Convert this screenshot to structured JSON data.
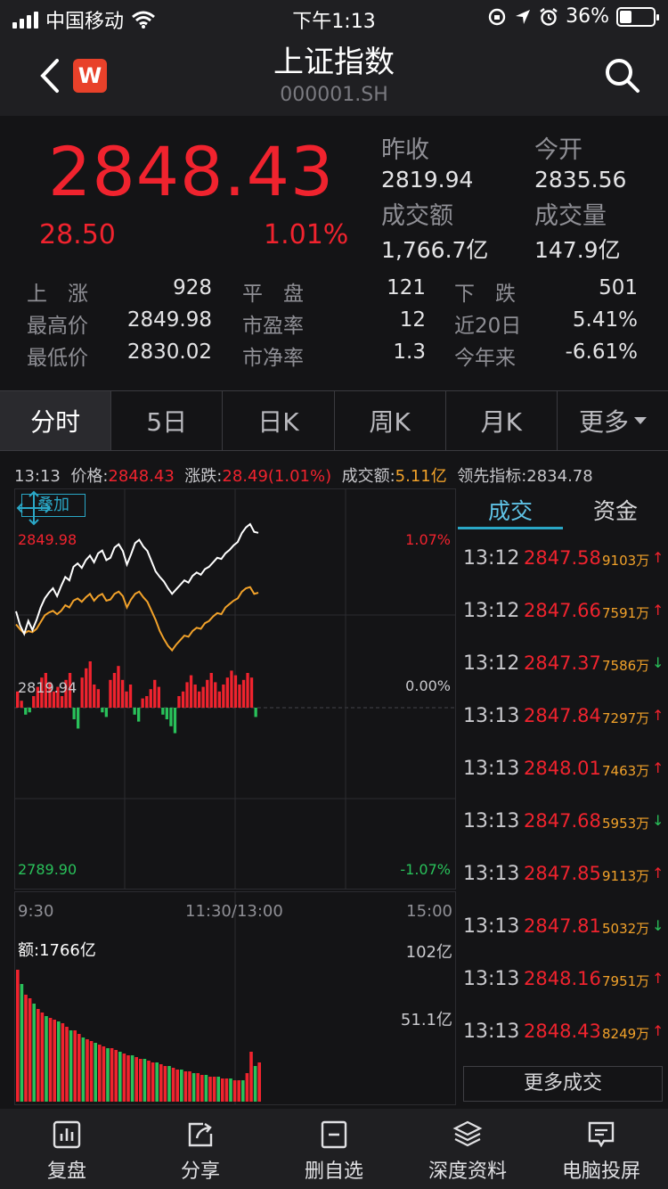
{
  "status_bar": {
    "carrier": "中国移动",
    "time": "下午1:13",
    "battery": "36%",
    "battery_level": 0.36
  },
  "header": {
    "title": "上证指数",
    "code": "000001.SH",
    "logo_text": "W"
  },
  "quote": {
    "price": "2848.43",
    "change": "28.50",
    "change_pct": "1.01%",
    "prev_close_label": "昨收",
    "prev_close": "2819.94",
    "open_label": "今开",
    "open": "2835.56",
    "turnover_label": "成交额",
    "turnover": "1,766.7亿",
    "volume_label": "成交量",
    "volume": "147.9亿"
  },
  "stats": [
    [
      {
        "label": "上　涨",
        "value": "928"
      },
      {
        "label": "平　盘",
        "value": "121"
      },
      {
        "label": "下　跌",
        "value": "501"
      }
    ],
    [
      {
        "label": "最高价",
        "value": "2849.98"
      },
      {
        "label": "市盈率",
        "value": "12"
      },
      {
        "label": "近20日",
        "value": "5.41%"
      }
    ],
    [
      {
        "label": "最低价",
        "value": "2830.02"
      },
      {
        "label": "市净率",
        "value": "1.3"
      },
      {
        "label": "今年来",
        "value": "-6.61%"
      }
    ]
  ],
  "tabs": [
    {
      "label": "分时"
    },
    {
      "label": "5日"
    },
    {
      "label": "日K"
    },
    {
      "label": "周K"
    },
    {
      "label": "月K"
    },
    {
      "label": "更多"
    }
  ],
  "info_line": {
    "time": "13:13",
    "price_label": "价格:",
    "price": "2848.43",
    "change_label": "涨跌:",
    "change": "28.49(1.01%)",
    "turnover_label": "成交额:",
    "turnover": "5.11亿",
    "lead_label": "领先指标:",
    "lead": "2834.78"
  },
  "chart": {
    "overlay_label": "叠加",
    "y_top": "2849.98",
    "y_mid": "2819.94",
    "y_bottom": "2789.90",
    "pct_top": "1.07%",
    "pct_mid": "0.00%",
    "pct_bottom": "-1.07%",
    "x_start": "9:30",
    "x_mid": "11:30/13:00",
    "x_end": "15:00",
    "amount_label": "额:1766亿",
    "amount_top": "102亿",
    "amount_mid": "51.1亿",
    "colors": {
      "up": "#f0232e",
      "down": "#29c15a",
      "price": "#ffffff",
      "avg": "#f2a22a"
    }
  },
  "chart_data": {
    "type": "line",
    "ylim": [
      2789.9,
      2849.98
    ],
    "series": [
      {
        "values": [
          2834.5,
          2832.0,
          2830.5,
          2832.8,
          2831.2,
          2833.0,
          2835.2,
          2836.8,
          2837.8,
          2838.6,
          2837.2,
          2839.0,
          2840.6,
          2840.0,
          2842.4,
          2843.0,
          2842.2,
          2843.6,
          2844.4,
          2843.2,
          2844.8,
          2845.3,
          2843.6,
          2844.0,
          2845.8,
          2846.4,
          2845.2,
          2842.8,
          2844.6,
          2846.6,
          2847.2,
          2846.0,
          2845.2,
          2843.4,
          2841.6,
          2840.6,
          2839.8,
          2838.6,
          2837.6,
          2838.4,
          2839.2,
          2840.0,
          2839.6,
          2840.8,
          2841.4,
          2841.0,
          2842.0,
          2842.4,
          2843.2,
          2844.0,
          2843.8,
          2844.8,
          2845.4,
          2846.2,
          2846.8,
          2848.4,
          2849.4,
          2849.98,
          2848.6,
          2848.43
        ]
      },
      {
        "values": [
          2832.2,
          2831.3,
          2830.6,
          2831.0,
          2830.8,
          2831.4,
          2832.6,
          2833.8,
          2834.3,
          2834.6,
          2834.0,
          2834.6,
          2835.6,
          2835.2,
          2836.4,
          2836.8,
          2836.2,
          2837.0,
          2837.6,
          2836.4,
          2837.2,
          2837.6,
          2836.4,
          2836.6,
          2837.6,
          2838.0,
          2837.2,
          2835.2,
          2836.6,
          2837.6,
          2838.0,
          2837.0,
          2836.2,
          2834.6,
          2833.0,
          2831.0,
          2829.6,
          2828.4,
          2827.6,
          2828.6,
          2829.4,
          2830.2,
          2830.0,
          2831.0,
          2831.6,
          2831.4,
          2832.4,
          2832.8,
          2833.6,
          2834.2,
          2834.0,
          2835.2,
          2835.8,
          2836.4,
          2836.8,
          2838.0,
          2838.6,
          2838.8,
          2837.6,
          2837.8
        ]
      }
    ],
    "bars": [
      14,
      6,
      -6,
      -4,
      10,
      18,
      26,
      30,
      22,
      14,
      18,
      10,
      24,
      30,
      -10,
      -18,
      26,
      34,
      40,
      20,
      16,
      -4,
      -8,
      24,
      30,
      36,
      24,
      14,
      20,
      -6,
      -12,
      8,
      10,
      16,
      24,
      18,
      -6,
      -10,
      -16,
      -22,
      10,
      14,
      22,
      28,
      20,
      14,
      18,
      24,
      30,
      22,
      14,
      20,
      26,
      32,
      28,
      20,
      24,
      30,
      26,
      -8
    ],
    "amounts": [
      74,
      66,
      60,
      58,
      55,
      52,
      50,
      48,
      47,
      46,
      45,
      44,
      42,
      40,
      40,
      38,
      36,
      35,
      34,
      33,
      32,
      31,
      30,
      30,
      29,
      28,
      27,
      26,
      26,
      25,
      24,
      24,
      23,
      22,
      22,
      21,
      20,
      20,
      19,
      18,
      18,
      17,
      17,
      16,
      16,
      15,
      15,
      14,
      14,
      14,
      13,
      13,
      13,
      12,
      12,
      12,
      16,
      28,
      20,
      22
    ]
  },
  "trades": {
    "tabs": [
      {
        "label": "成交"
      },
      {
        "label": "资金"
      }
    ],
    "rows": [
      {
        "time": "13:12",
        "price": "2847.58",
        "vol": "9103万",
        "dir": "↑",
        "up": true
      },
      {
        "time": "13:12",
        "price": "2847.66",
        "vol": "7591万",
        "dir": "↑",
        "up": true
      },
      {
        "time": "13:12",
        "price": "2847.37",
        "vol": "7586万",
        "dir": "↓",
        "up": false
      },
      {
        "time": "13:13",
        "price": "2847.84",
        "vol": "7297万",
        "dir": "↑",
        "up": true
      },
      {
        "time": "13:13",
        "price": "2848.01",
        "vol": "7463万",
        "dir": "↑",
        "up": true
      },
      {
        "time": "13:13",
        "price": "2847.68",
        "vol": "5953万",
        "dir": "↓",
        "up": false
      },
      {
        "time": "13:13",
        "price": "2847.85",
        "vol": "9113万",
        "dir": "↑",
        "up": true
      },
      {
        "time": "13:13",
        "price": "2847.81",
        "vol": "5032万",
        "dir": "↓",
        "up": false
      },
      {
        "time": "13:13",
        "price": "2848.16",
        "vol": "7951万",
        "dir": "↑",
        "up": true
      },
      {
        "time": "13:13",
        "price": "2848.43",
        "vol": "8249万",
        "dir": "↑",
        "up": true
      }
    ],
    "more_label": "更多成交"
  },
  "bottom_bar": [
    {
      "label": "复盘",
      "icon": "chart-bars-icon"
    },
    {
      "label": "分享",
      "icon": "share-icon"
    },
    {
      "label": "删自选",
      "icon": "remove-watchlist-icon"
    },
    {
      "label": "深度资料",
      "icon": "layers-icon"
    },
    {
      "label": "电脑投屏",
      "icon": "cast-screen-icon"
    }
  ]
}
